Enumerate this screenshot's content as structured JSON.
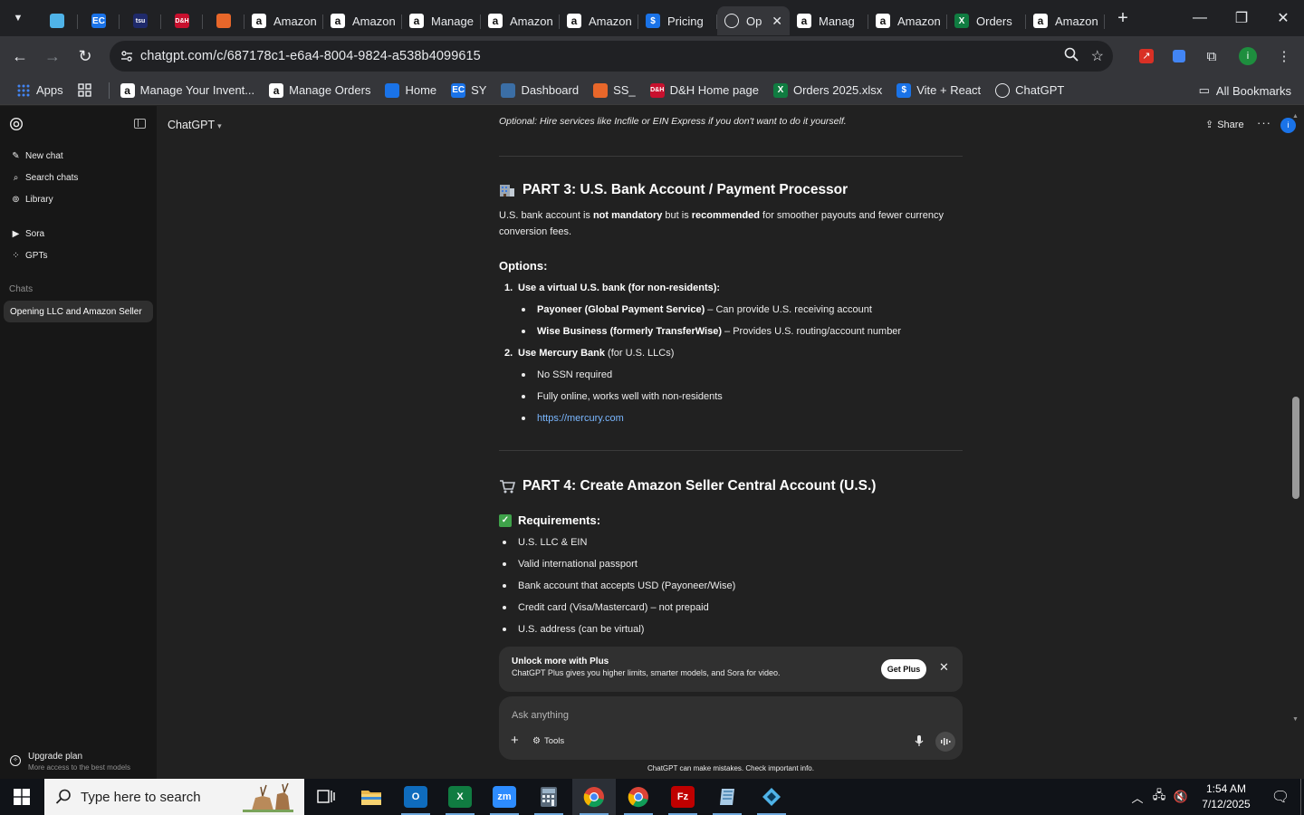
{
  "browser": {
    "tabs": [
      {
        "icon": "purple-app-icon",
        "label": "",
        "color": "#4fb3e8",
        "text": ""
      },
      {
        "icon": "ec-icon",
        "label": "",
        "color": "#1a73e8",
        "text": "EC"
      },
      {
        "icon": "tsu-icon",
        "label": "",
        "color": "#1f2a6b",
        "text": "tsu"
      },
      {
        "icon": "dh-icon",
        "label": "",
        "color": "#c8102e",
        "text": "D&H"
      },
      {
        "icon": "stack-icon",
        "label": "",
        "color": "#e8672a",
        "text": ""
      },
      {
        "icon": "amazon-icon",
        "label": "Amazon",
        "color": "#ffffff",
        "text": "a"
      },
      {
        "icon": "amazon-icon",
        "label": "Amazon",
        "color": "#ffffff",
        "text": "a"
      },
      {
        "icon": "amazon-icon",
        "label": "Manage",
        "color": "#ffffff",
        "text": "a"
      },
      {
        "icon": "amazon-icon",
        "label": "Amazon",
        "color": "#ffffff",
        "text": "a"
      },
      {
        "icon": "amazon-icon",
        "label": "Amazon",
        "color": "#ffffff",
        "text": "a"
      },
      {
        "icon": "dollar-icon",
        "label": "Pricing",
        "color": "#1a73e8",
        "text": "$"
      },
      {
        "icon": "chatgpt-icon",
        "label": "Op",
        "color": "#e8eaed",
        "text": "",
        "active": true
      },
      {
        "icon": "amazon-icon",
        "label": "Manag",
        "color": "#ffffff",
        "text": "a"
      },
      {
        "icon": "amazon-icon",
        "label": "Amazon",
        "color": "#ffffff",
        "text": "a"
      },
      {
        "icon": "excel-icon",
        "label": "Orders",
        "color": "#107c41",
        "text": "X"
      },
      {
        "icon": "amazon-icon",
        "label": "Amazon",
        "color": "#ffffff",
        "text": "a"
      }
    ],
    "url": "chatgpt.com/c/687178c1-e6a4-8004-9824-a538b4099615",
    "bookmarks": [
      {
        "icon": "apps-grid-icon",
        "label": "Apps",
        "color": "#1a73e8",
        "text": ""
      },
      {
        "icon": "tab-groups-icon",
        "label": "",
        "color": "",
        "text": ""
      },
      {
        "icon": "amazon-icon",
        "label": "Manage Your Invent...",
        "color": "#ffffff",
        "text": "a"
      },
      {
        "icon": "amazon-icon",
        "label": "Manage Orders",
        "color": "#ffffff",
        "text": "a"
      },
      {
        "icon": "home-icon",
        "label": "Home",
        "color": "#1a73e8",
        "text": ""
      },
      {
        "icon": "ec-icon",
        "label": "SY",
        "color": "#1a73e8",
        "text": "EC"
      },
      {
        "icon": "dashboard-icon",
        "label": "Dashboard",
        "color": "#3b6ea5",
        "text": ""
      },
      {
        "icon": "stack-icon",
        "label": "SS_",
        "color": "#e8672a",
        "text": ""
      },
      {
        "icon": "dh-icon",
        "label": "D&H Home page",
        "color": "#c8102e",
        "text": "D&H"
      },
      {
        "icon": "excel-icon",
        "label": "Orders 2025.xlsx",
        "color": "#107c41",
        "text": "X"
      },
      {
        "icon": "dollar-icon",
        "label": "Vite + React",
        "color": "#1a73e8",
        "text": "$"
      },
      {
        "icon": "chatgpt-icon",
        "label": "ChatGPT",
        "color": "#e8eaed",
        "text": ""
      }
    ],
    "all_bookmarks": "All Bookmarks",
    "profile_initial": "i"
  },
  "sidebar": {
    "items": [
      {
        "icon": "new-chat-icon",
        "glyph": "✎",
        "label": "New chat"
      },
      {
        "icon": "search-icon",
        "glyph": "⌕",
        "label": "Search chats"
      },
      {
        "icon": "library-icon",
        "glyph": "⊚",
        "label": "Library"
      }
    ],
    "items2": [
      {
        "icon": "sora-icon",
        "glyph": "▶",
        "label": "Sora"
      },
      {
        "icon": "gpts-icon",
        "glyph": "⁘",
        "label": "GPTs"
      }
    ],
    "chats_heading": "Chats",
    "active_chat": "Opening LLC and Amazon Seller",
    "upgrade_title": "Upgrade plan",
    "upgrade_sub": "More access to the best models"
  },
  "header": {
    "model": "ChatGPT",
    "share": "Share",
    "avatar": "i"
  },
  "content": {
    "optional_note": "Optional: Hire services like Incfile or EIN Express if you don't want to do it yourself.",
    "part3_title": "PART 3: U.S. Bank Account / Payment Processor",
    "part3_intro_1": "U.S. bank account is ",
    "part3_intro_b1": "not mandatory",
    "part3_intro_2": " but is ",
    "part3_intro_b2": "recommended",
    "part3_intro_3": " for smoother payouts and fewer currency",
    "part3_intro_4": "conversion fees.",
    "options_heading": "Options:",
    "opt1_num": "1.",
    "opt1": "Use a virtual U.S. bank (for non-residents):",
    "opt1_a_b": "Payoneer (Global Payment Service)",
    "opt1_a": " – Can provide U.S. receiving account",
    "opt1_b_b": "Wise Business (formerly TransferWise)",
    "opt1_b": " – Provides U.S. routing/account number",
    "opt2_num": "2.",
    "opt2_b": "Use Mercury Bank",
    "opt2": " (for U.S. LLCs)",
    "opt2_a": "No SSN required",
    "opt2_b2": "Fully online, works well with non-residents",
    "opt2_c": "https://mercury.com",
    "part4_title": "PART 4: Create Amazon Seller Central Account (U.S.)",
    "req_heading": "Requirements:",
    "requirements": [
      "U.S. LLC & EIN",
      "Valid international passport",
      "Bank account that accepts USD (Payoneer/Wise)",
      "Credit card (Visa/Mastercard) – not prepaid",
      "U.S. address (can be virtual)"
    ]
  },
  "banner": {
    "title": "Unlock more with Plus",
    "desc": "ChatGPT Plus gives you higher limits, smarter models, and Sora for video.",
    "button": "Get Plus"
  },
  "composer": {
    "placeholder": "Ask anything",
    "tools": "Tools",
    "disclaimer": "ChatGPT can make mistakes. Check important info."
  },
  "taskbar": {
    "search_placeholder": "Type here to search",
    "time": "1:54 AM",
    "date": "7/12/2025",
    "apps": [
      {
        "icon": "task-view-icon",
        "color": "",
        "text": ""
      },
      {
        "icon": "file-explorer-icon",
        "color": "#f2c14e",
        "text": ""
      },
      {
        "icon": "outlook-icon",
        "color": "#0f6cbd",
        "text": "O"
      },
      {
        "icon": "excel-icon",
        "color": "#107c41",
        "text": "X"
      },
      {
        "icon": "zoom-icon",
        "color": "#2d8cff",
        "text": "zm"
      },
      {
        "icon": "calculator-icon",
        "color": "#5c6b7a",
        "text": ""
      },
      {
        "icon": "chrome-icon",
        "color": "#dd4b39",
        "text": "",
        "active": true
      },
      {
        "icon": "chrome-icon",
        "color": "#dd4b39",
        "text": ""
      },
      {
        "icon": "filezilla-icon",
        "color": "#bf0000",
        "text": "Fz"
      },
      {
        "icon": "notepad-icon",
        "color": "#7fb3d5",
        "text": ""
      },
      {
        "icon": "diamond-app-icon",
        "color": "#4fb3e8",
        "text": ""
      }
    ]
  }
}
